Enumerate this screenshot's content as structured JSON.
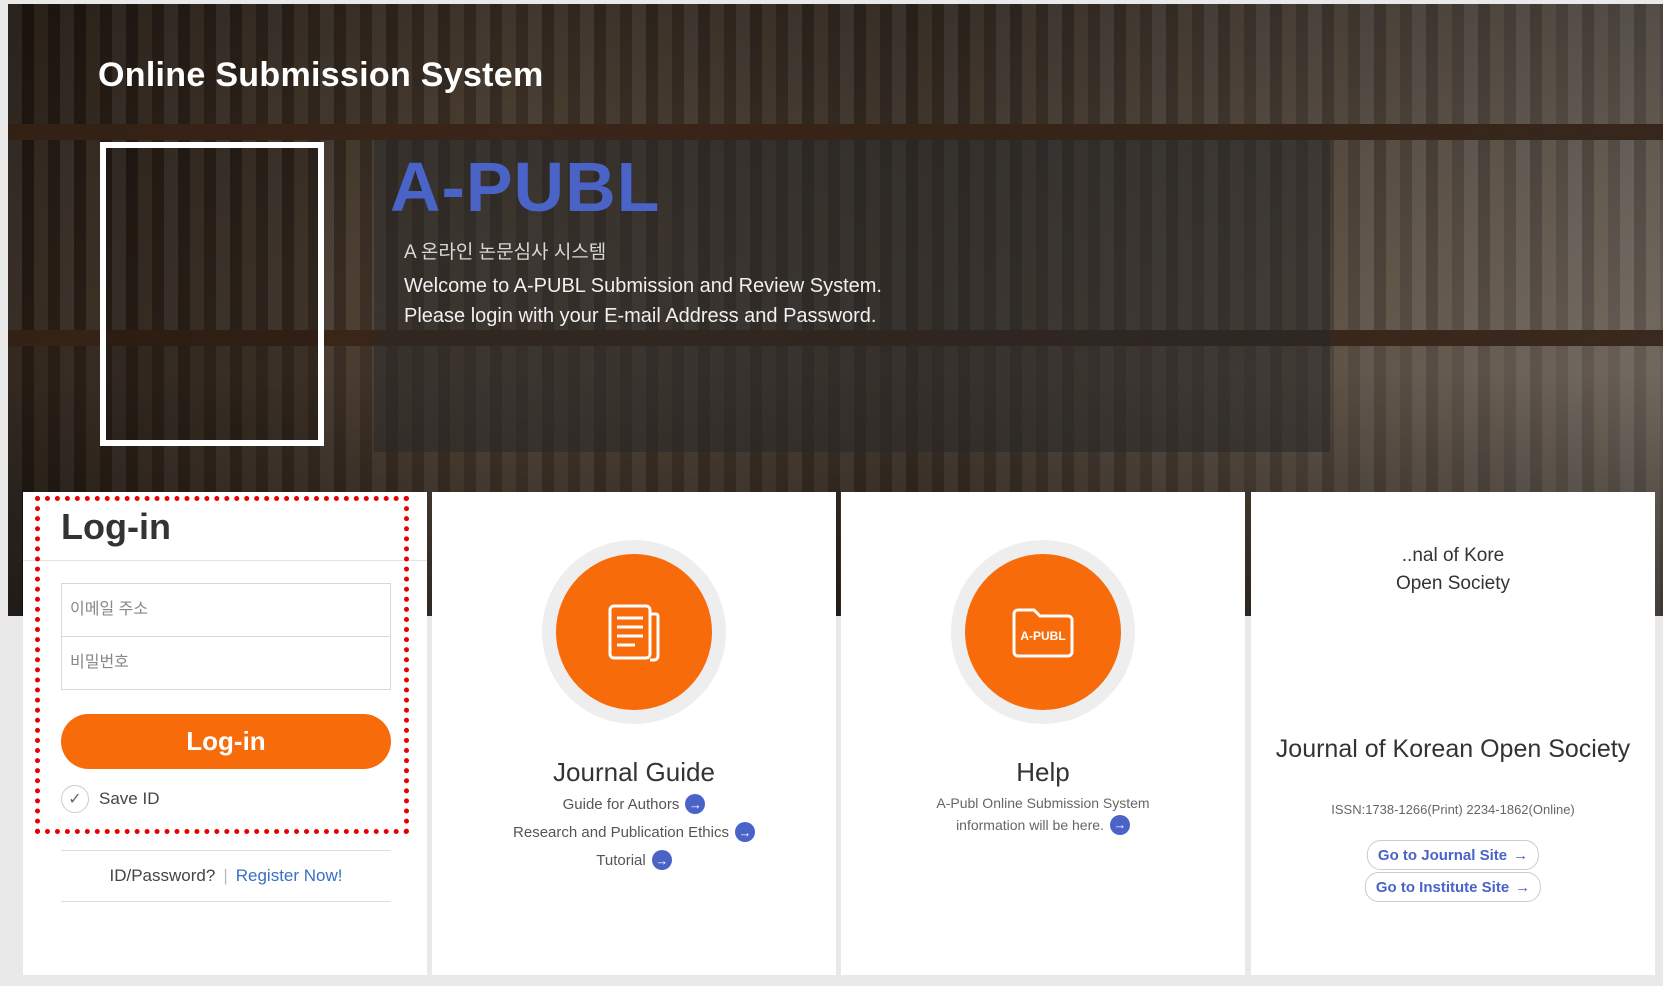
{
  "hero": {
    "site_title": "Online Submission System",
    "logo_text": "A-PUBL",
    "korean_subtitle": "A 온라인 논문심사 시스템",
    "welcome_line1": "Welcome to A-PUBL Submission and Review System.",
    "welcome_line2": "Please login with your E-mail Address and Password."
  },
  "login": {
    "title": "Log-in",
    "email_placeholder": "이메일 주소",
    "password_placeholder": "비밀번호",
    "button_label": "Log-in",
    "save_id_label": "Save ID",
    "save_id_checked": true,
    "id_password_text": "ID/Password?",
    "separator": "|",
    "register_text": "Register Now!"
  },
  "guide": {
    "title": "Journal Guide",
    "links": [
      "Guide for Authors",
      "Research and Publication Ethics",
      "Tutorial"
    ]
  },
  "help": {
    "title": "Help",
    "icon_text": "A-PUBL",
    "desc_line1": "A-Publ Online Submission System",
    "desc_line2": "information will be here."
  },
  "journal": {
    "logo_line1": "..nal of Kore",
    "logo_line2": "Open Society",
    "title": "Journal of Korean Open Society",
    "issn": "ISSN:1738-1266(Print) 2234-1862(Online)",
    "journal_site_label": "Go to Journal Site",
    "institute_site_label": "Go to Institute Site"
  },
  "colors": {
    "accent_orange": "#f76b0b",
    "brand_blue": "#4a63c7",
    "highlight_red": "#e60000"
  }
}
